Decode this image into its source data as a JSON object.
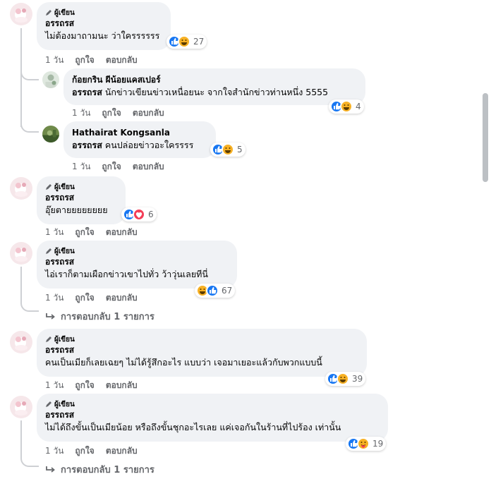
{
  "author_badge": "ผู้เขียน",
  "action_labels": {
    "like": "ถูกใจ",
    "reply": "ตอบกลับ"
  },
  "comments": [
    {
      "author": "อรรถรส",
      "badge": true,
      "text": "ไม่ต้องมาถามนะ ว่าใครรรรรร",
      "time": "1 วัน",
      "reactions": [
        "like",
        "haha"
      ],
      "count": "27"
    },
    {
      "author": "ก้อยกริน ผีน้อยแคสเปอร์",
      "mention": "อรรถรส",
      "text": "นักข่าวเขียนข่าวเหนื่อยนะ จากใจสำนักข่าวท่านหนึ่ง 5555",
      "time": "1 วัน",
      "reactions": [
        "like",
        "haha"
      ],
      "count": "4"
    },
    {
      "author": "Hathairat Kongsanla",
      "mention": "อรรถรส",
      "text": "คนปล่อยข่าวอะใครรรร",
      "time": "1 วัน",
      "reactions": [
        "like",
        "haha"
      ],
      "count": "5"
    },
    {
      "author": "อรรถรส",
      "badge": true,
      "text": "อุ๊ยตายยยยยยยย",
      "time": "1 วัน",
      "reactions": [
        "like",
        "love"
      ],
      "count": "6"
    },
    {
      "author": "อรรถรส",
      "badge": true,
      "text": "ไอ่เราก็ตามเผือกข่าวเขาไปทั่ว ว้าวุ่นเลยทีนี่",
      "time": "1 วัน",
      "reactions": [
        "haha",
        "like"
      ],
      "count": "67",
      "more_replies": "การตอบกลับ 1 รายการ"
    },
    {
      "author": "อรรถรส",
      "badge": true,
      "text": "คนเป็นเมียก็เลยเฉยๆ ไม่ได้รู้สึกอะไร แบบว่า เจอมาเยอะแล้วกับพวกแบบนี้",
      "time": "1 วัน",
      "reactions": [
        "like",
        "haha"
      ],
      "count": "39"
    },
    {
      "author": "อรรถรส",
      "badge": true,
      "text": "ไม่ได้ถึงขั้นเป็นเมียน้อย หรือถึงขั้นชุกอะไรเลย แค่เจอกันในร้านที่ไปร้อง เท่านั้น",
      "time": "1 วัน",
      "reactions": [
        "like",
        "care"
      ],
      "count": "19",
      "more_replies": "การตอบกลับ 1 รายการ"
    }
  ],
  "colors": {
    "like": "#1877f2",
    "love": "#f33e58",
    "haha": "#f7b125",
    "bubble": "#f0f2f5",
    "muted": "#65676b"
  }
}
